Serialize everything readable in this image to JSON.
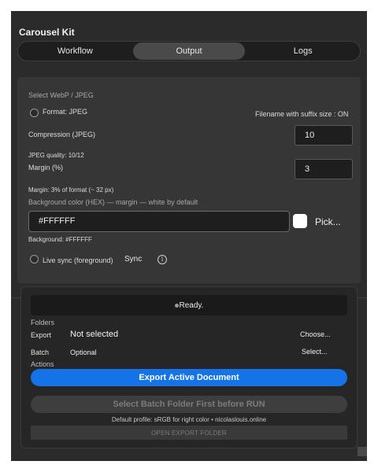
{
  "app": {
    "title": "Carousel Kit"
  },
  "tabs": [
    {
      "label": "Workflow",
      "active": false
    },
    {
      "label": "Output",
      "active": true
    },
    {
      "label": "Logs",
      "active": false
    }
  ],
  "output": {
    "section_label": "Select WebP / JPEG",
    "format_label": "Format: JPEG",
    "filename_suffix": "Filename with suffix size : ON",
    "compression_label": "Compression (JPEG)",
    "compression_value": "10",
    "quality_text": "JPEG quality: 10/12",
    "margin_label": "Margin (%)",
    "margin_value": "3",
    "margin_text": "Margin: 3% of format (~ 32 px)",
    "bg_label": "Background color (HEX) — margin — white by default",
    "bg_value": "#FFFFFF",
    "pick_label": "Pick...",
    "bg_text": "Background: #FFFFFF",
    "live_sync_label": "Live sync (foreground)",
    "sync_button": "Sync",
    "info_icon": "ⓘ"
  },
  "actions_panel": {
    "status": "Ready.",
    "folders_title": "Folders",
    "export_label": "Export",
    "export_value": "Not selected",
    "choose_button": "Choose...",
    "batch_label": "Batch",
    "batch_value": "Optional",
    "select_button": "Select...",
    "actions_title": "Actions",
    "export_active_button": "Export Active Document",
    "run_button": "Select Batch Folder First before RUN",
    "profile_text": "Default profile: sRGB for right color • nicolaslouis.online",
    "open_folder_button": "OPEN EXPORT FOLDER"
  },
  "colors": {
    "accent": "#1473e6",
    "background": "#2b2b2b",
    "panel": "#363636"
  }
}
